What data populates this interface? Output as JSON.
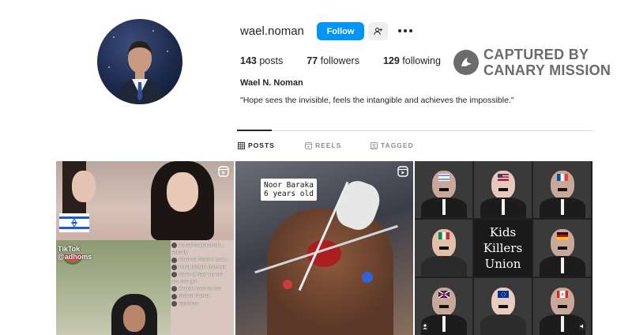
{
  "profile": {
    "username": "wael.noman",
    "follow_label": "Follow",
    "stats": {
      "posts_count": "143",
      "posts_label": "posts",
      "followers_count": "77",
      "followers_label": "followers",
      "following_count": "129",
      "following_label": "following"
    },
    "full_name": "Wael N. Noman",
    "bio": "\"Hope sees the invisible, feels the intangible and achieves the impossible.\""
  },
  "watermark": {
    "line1": "CAPTURED BY",
    "line2": "CANARY MISSION"
  },
  "tabs": [
    {
      "label": "POSTS",
      "active": true
    },
    {
      "label": "REELS",
      "active": false
    },
    {
      "label": "TAGGED",
      "active": false
    }
  ],
  "posts": [
    {
      "overlay_app": "TikTok",
      "overlay_handle": "@adhoms",
      "comments": [
        "DoraDoraDoratheE...",
        "actually",
        "Amanda Norton: Excu...",
        "THALISSON GAMER",
        "Rae's & Ray: lay are",
        "you see girl",
        "ZAyeD: were is tsra",
        "Manan Nawaz",
        "Tsochess"
      ]
    },
    {
      "caption_line1": "Noor Baraka",
      "caption_line2": "6 years old"
    },
    {
      "center_line1": "Kids",
      "center_line2": "Killers",
      "center_line3": "Union"
    }
  ],
  "colors": {
    "follow_button": "#0095f6",
    "text_primary": "#262626",
    "text_secondary": "#8e8e8e",
    "watermark": "#6b6b6b",
    "divider": "#dbdbdb"
  }
}
